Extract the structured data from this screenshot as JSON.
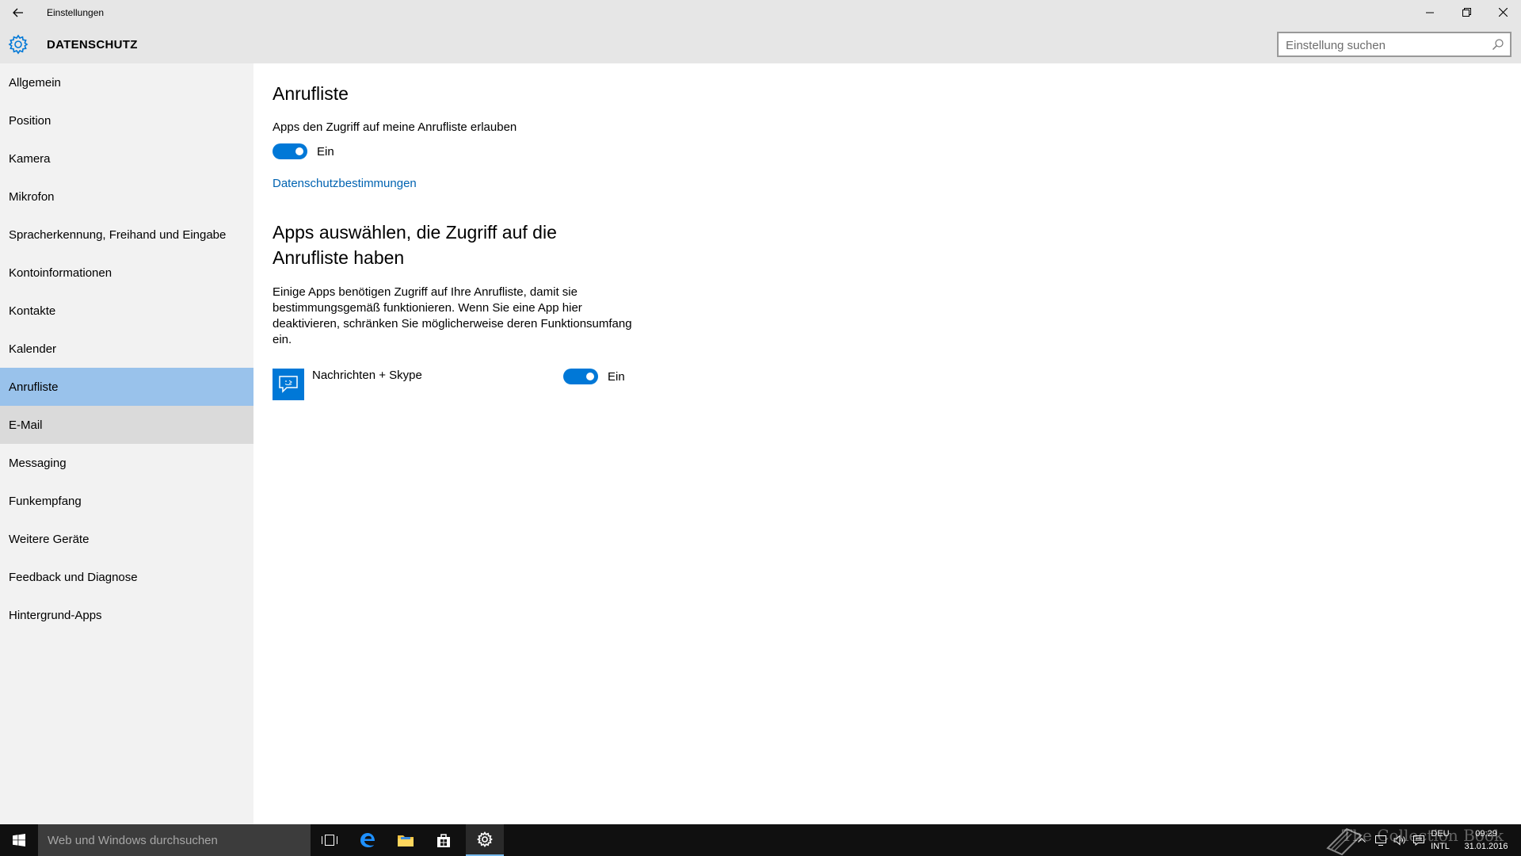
{
  "window": {
    "title": "Einstellungen"
  },
  "header": {
    "title": "DATENSCHUTZ",
    "search_placeholder": "Einstellung suchen"
  },
  "sidebar": {
    "items": [
      {
        "label": "Allgemein"
      },
      {
        "label": "Position"
      },
      {
        "label": "Kamera"
      },
      {
        "label": "Mikrofon"
      },
      {
        "label": "Spracherkennung, Freihand und Eingabe"
      },
      {
        "label": "Kontoinformationen"
      },
      {
        "label": "Kontakte"
      },
      {
        "label": "Kalender"
      },
      {
        "label": "Anrufliste"
      },
      {
        "label": "E-Mail"
      },
      {
        "label": "Messaging"
      },
      {
        "label": "Funkempfang"
      },
      {
        "label": "Weitere Geräte"
      },
      {
        "label": "Feedback und Diagnose"
      },
      {
        "label": "Hintergrund-Apps"
      }
    ],
    "selected": "Anrufliste",
    "hovered": "E-Mail"
  },
  "main": {
    "title": "Anrufliste",
    "allow_label": "Apps den Zugriff auf meine Anrufliste erlauben",
    "allow_toggle": {
      "state": "Ein",
      "on": true
    },
    "privacy_link": "Datenschutzbestimmungen",
    "apps_heading": "Apps auswählen, die Zugriff auf die Anrufliste haben",
    "apps_description": "Einige Apps benötigen Zugriff auf Ihre Anrufliste, damit sie bestimmungsgemäß funktionieren. Wenn Sie eine App hier deaktivieren, schränken Sie möglicherweise deren Funktionsumfang ein.",
    "apps": [
      {
        "name": "Nachrichten + Skype",
        "state": "Ein",
        "on": true,
        "icon": "chat-bubble-icon"
      }
    ]
  },
  "taskbar": {
    "search_placeholder": "Web und Windows durchsuchen",
    "language_line1": "DEU",
    "language_line2": "INTL",
    "time": "09:29",
    "date": "31.01.2016",
    "watermark": "The Collection Book"
  },
  "colors": {
    "accent": "#0078d7",
    "selected_bg": "#99c2eb",
    "link": "#0063b1",
    "chrome": "#e6e6e6",
    "sidebar": "#f2f2f2",
    "taskbar": "#101010"
  }
}
